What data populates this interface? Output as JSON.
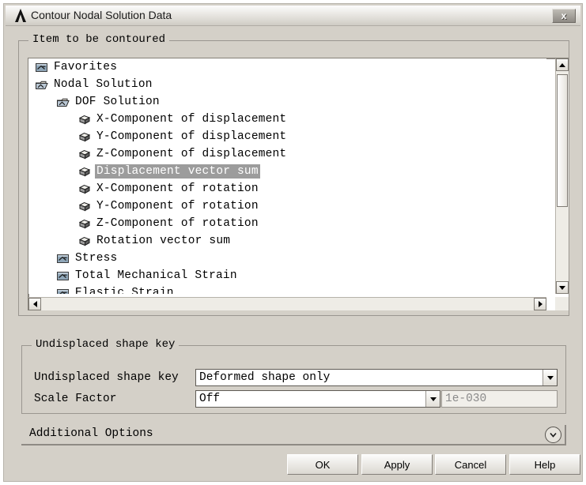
{
  "window": {
    "title": "Contour Nodal Solution Data",
    "logo_icon": "ansys-lambda-logo",
    "close_label": "x"
  },
  "item_group": {
    "title": "Item to be contoured",
    "tree": [
      {
        "label": "Favorites",
        "indent": 0,
        "icon": "folder-closed-icon",
        "selected": false
      },
      {
        "label": "Nodal Solution",
        "indent": 0,
        "icon": "folder-open-icon",
        "selected": false
      },
      {
        "label": "DOF Solution",
        "indent": 1,
        "icon": "folder-open-icon",
        "selected": false
      },
      {
        "label": "X-Component of displacement",
        "indent": 2,
        "icon": "cube-icon",
        "selected": false
      },
      {
        "label": "Y-Component of displacement",
        "indent": 2,
        "icon": "cube-icon",
        "selected": false
      },
      {
        "label": "Z-Component of displacement",
        "indent": 2,
        "icon": "cube-icon",
        "selected": false
      },
      {
        "label": "Displacement vector sum",
        "indent": 2,
        "icon": "cube-icon",
        "selected": true
      },
      {
        "label": "X-Component of rotation",
        "indent": 2,
        "icon": "cube-icon",
        "selected": false
      },
      {
        "label": "Y-Component of rotation",
        "indent": 2,
        "icon": "cube-icon",
        "selected": false
      },
      {
        "label": "Z-Component of rotation",
        "indent": 2,
        "icon": "cube-icon",
        "selected": false
      },
      {
        "label": "Rotation vector sum",
        "indent": 2,
        "icon": "cube-icon",
        "selected": false
      },
      {
        "label": "Stress",
        "indent": 1,
        "icon": "folder-closed-icon",
        "selected": false
      },
      {
        "label": "Total Mechanical Strain",
        "indent": 1,
        "icon": "folder-closed-icon",
        "selected": false
      },
      {
        "label": "Elastic Strain",
        "indent": 1,
        "icon": "folder-closed-icon",
        "selected": false
      }
    ],
    "scrollbars": {
      "vertical_up_icon": "scroll-up-arrow-icon",
      "vertical_down_icon": "scroll-down-arrow-icon",
      "horizontal_left_icon": "scroll-left-arrow-icon",
      "horizontal_right_icon": "scroll-right-arrow-icon"
    }
  },
  "undisplaced_group": {
    "title": "Undisplaced shape key",
    "shape_key": {
      "label": "Undisplaced shape key",
      "value": "Deformed shape only",
      "arrow_icon": "chevron-down-icon"
    },
    "scale_factor": {
      "label": "Scale Factor",
      "value": "Off",
      "arrow_icon": "chevron-down-icon",
      "custom_value": "1e-030"
    }
  },
  "additional_options": {
    "label": "Additional Options",
    "expander_icon": "circled-chevron-down-icon"
  },
  "buttons": {
    "ok": "OK",
    "apply": "Apply",
    "cancel": "Cancel",
    "help": "Help"
  },
  "colors": {
    "dialog_face": "#d4d0c8",
    "selection": "#9c9c9c",
    "field_bg": "#ffffff",
    "disabled_text": "#8a8a8a"
  }
}
